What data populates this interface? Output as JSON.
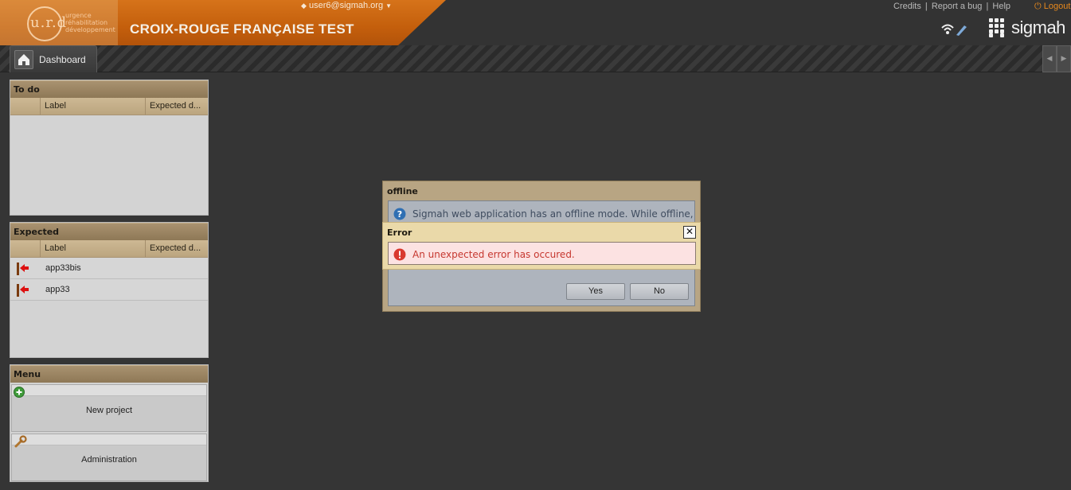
{
  "header": {
    "user_email": "user6@sigmah.org",
    "org_title": "CROIX-ROUGE FRANÇAISE TEST",
    "logo_text": "u.r.d",
    "logo_words": [
      "urgence",
      "réhabilitation",
      "développement"
    ],
    "links": [
      "Credits",
      "Report a bug",
      "Help"
    ],
    "link_sep": "|",
    "logout_label": "Logout",
    "brand": "sigmah"
  },
  "tabs": [
    {
      "label": "Dashboard",
      "icon": "home-icon"
    }
  ],
  "todo": {
    "title": "To do",
    "columns": [
      "Label",
      "Expected d..."
    ]
  },
  "expected": {
    "title": "Expected",
    "columns": [
      "Label",
      "Expected d..."
    ],
    "rows": [
      {
        "label": "app33bis",
        "expected": ""
      },
      {
        "label": "app33",
        "expected": ""
      }
    ]
  },
  "menu": {
    "title": "Menu",
    "items": [
      {
        "label": "New project",
        "icon": "add-icon"
      },
      {
        "label": "Administration",
        "icon": "wrench-icon"
      }
    ]
  },
  "offline_dialog": {
    "title": "offline",
    "message": "Sigmah web application has an offline mode. While offline,",
    "yes_label": "Yes",
    "no_label": "No"
  },
  "error_dialog": {
    "title": "Error",
    "message": "An unexpected error has occured.",
    "close_symbol": "✕"
  },
  "colors": {
    "header_orange": "#c45f0c",
    "panel_head": "#9a8462",
    "error_text": "#c6372f",
    "background": "#353535"
  }
}
